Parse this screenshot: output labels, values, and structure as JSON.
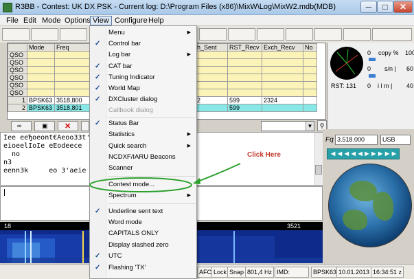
{
  "window": {
    "title": "R3BB - Contest: UK DX PSK - Current log: D:\\Program Files (x86)\\MixW\\Log\\MixW2.mdb(MDB)",
    "minimize": "─",
    "maximize": "□",
    "close": "✕"
  },
  "menubar": [
    "File",
    "Edit",
    "Mode",
    "Options",
    "View",
    "Configure",
    "Help"
  ],
  "log_table": {
    "columns": [
      "",
      "Mode",
      "Freq",
      "Exch_Sent",
      "RST_Recv",
      "Exch_Recv",
      "No"
    ],
    "rows": [
      {
        "head": "QSO",
        "cells": [
          "",
          "",
          "",
          "",
          "",
          ""
        ]
      },
      {
        "head": "QSO",
        "cells": [
          "",
          "",
          "",
          "",
          "",
          ""
        ]
      },
      {
        "head": "QSO",
        "cells": [
          "",
          "",
          "",
          "",
          "",
          ""
        ]
      },
      {
        "head": "QSO",
        "cells": [
          "",
          "",
          "",
          "",
          "",
          ""
        ]
      },
      {
        "head": "QSO",
        "cells": [
          "",
          "",
          "",
          "",
          "",
          ""
        ]
      },
      {
        "head": "QSO",
        "cells": [
          "",
          "",
          "",
          "",
          "",
          ""
        ]
      },
      {
        "head": "1",
        "cells": [
          "BPSK63",
          "3518,800",
          "2422",
          "599",
          "2324",
          ""
        ]
      },
      {
        "head": "2",
        "cells": [
          "BPSK63",
          "3518,801",
          "",
          "599",
          "",
          ""
        ]
      }
    ]
  },
  "meters": {
    "copy_value": "0",
    "copy_label": "copy %",
    "copy_max": "100",
    "sn_value": "0",
    "sn_label": "s/n |",
    "sn_max": "60",
    "ilm_value": "0",
    "ilm_label": "i l m |",
    "ilm_max": "40",
    "rst": "RST: 131"
  },
  "rx_text": "Iee eeЂoeont€Aeoo33t'\neioeelIoIe eEodeece\n  no\nn3\neenn3k     eo 3'aeie",
  "annotation": {
    "click_here": "Click Here"
  },
  "waterfall": {
    "left_label": "18",
    "right_label": "3521"
  },
  "freq": {
    "label": "Fq",
    "value": "3.518.000",
    "mode": "USB",
    "tuner_arrows": "◄◄◄◄◄►►►►►"
  },
  "view_menu": [
    {
      "label": "Menu",
      "checked": false,
      "submenu": true
    },
    {
      "label": "Control bar",
      "checked": true,
      "submenu": false
    },
    {
      "label": "Log bar",
      "checked": false,
      "submenu": true
    },
    {
      "label": "CAT bar",
      "checked": true,
      "submenu": false
    },
    {
      "label": "Tuning Indicator",
      "checked": true,
      "submenu": false
    },
    {
      "label": "World Map",
      "checked": true,
      "submenu": false
    },
    {
      "label": "DXCluster dialog",
      "checked": true,
      "submenu": false
    },
    {
      "label": "Callbook dialog",
      "checked": false,
      "submenu": false,
      "disabled": true
    },
    {
      "label": "Status Bar",
      "checked": true,
      "submenu": false
    },
    {
      "label": "Statistics",
      "checked": false,
      "submenu": true
    },
    {
      "label": "Quick search",
      "checked": false,
      "submenu": true
    },
    {
      "label": "NCDXF/IARU Beacons",
      "checked": false,
      "submenu": false
    },
    {
      "label": "Scanner",
      "checked": false,
      "submenu": false
    },
    {
      "label": "Contest mode...",
      "checked": false,
      "submenu": false
    },
    {
      "label": "Spectrum",
      "checked": false,
      "submenu": true
    },
    {
      "label": "Underline sent text",
      "checked": true,
      "submenu": false
    },
    {
      "label": "Word mode",
      "checked": false,
      "submenu": false
    },
    {
      "label": "CAPITALS ONLY",
      "checked": false,
      "submenu": false
    },
    {
      "label": "Display slashed zero",
      "checked": false,
      "submenu": false
    },
    {
      "label": "UTC",
      "checked": true,
      "submenu": false
    },
    {
      "label": "Flashing 'TX'",
      "checked": true,
      "submenu": false
    }
  ],
  "statusbar": {
    "afc": "AFC",
    "lock": "Lock",
    "snap": "Snap",
    "hz": "801,4 Hz",
    "imd": "IMD:",
    "mode": "BPSK63",
    "date": "10.01.2013",
    "time": "16:34:51 z"
  },
  "colors": {
    "annotation": "#2ca02c",
    "click_here": "#c0392b",
    "check": "#1c4a9a"
  }
}
